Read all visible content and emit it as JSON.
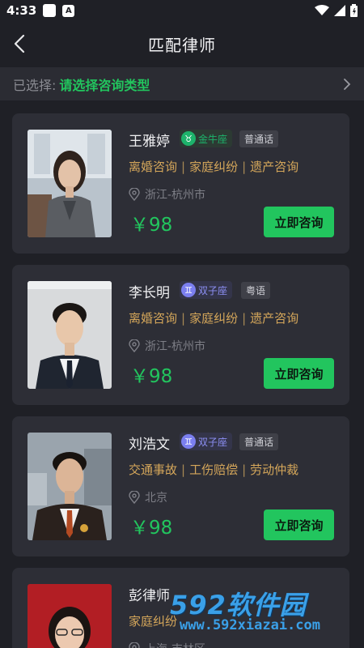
{
  "status_bar": {
    "time": "4:33",
    "notif_letter": "A"
  },
  "header": {
    "title": "匹配律师"
  },
  "selector": {
    "label": "已选择:",
    "value": "请选择咨询类型"
  },
  "lawyers": [
    {
      "name": "王雅婷",
      "zodiac": {
        "label": "金牛座",
        "symbol": "♉",
        "icon_color": "#1db36b",
        "text_color": "#1db36b",
        "bg": "#2c3a33"
      },
      "language": "普通话",
      "specialties": [
        "离婚咨询",
        "家庭纠纷",
        "遗产咨询"
      ],
      "location": "浙江-杭州市",
      "price": "￥98",
      "button": "立即咨询"
    },
    {
      "name": "李长明",
      "zodiac": {
        "label": "双子座",
        "symbol": "♊",
        "icon_color": "#7b7ff0",
        "text_color": "#8c8ff4",
        "bg": "#34354a"
      },
      "language": "粤语",
      "specialties": [
        "离婚咨询",
        "家庭纠纷",
        "遗产咨询"
      ],
      "location": "浙江-杭州市",
      "price": "￥98",
      "button": "立即咨询"
    },
    {
      "name": "刘浩文",
      "zodiac": {
        "label": "双子座",
        "symbol": "♊",
        "icon_color": "#7b7ff0",
        "text_color": "#8c8ff4",
        "bg": "#34354a"
      },
      "language": "普通话",
      "specialties": [
        "交通事故",
        "工伤赔偿",
        "劳动仲裁"
      ],
      "location": "北京",
      "price": "￥98",
      "button": "立即咨询"
    },
    {
      "name": "彭律师",
      "specialties": [
        "家庭纠纷"
      ],
      "location": "上海-吉林区"
    }
  ],
  "watermark": {
    "brand": "592软件园",
    "url": "www.592xiazai.com"
  },
  "colors": {
    "accent": "#22c55e",
    "specialty": "#d4a65a",
    "card_bg": "#2d2e36",
    "page_bg": "#1f2026"
  }
}
